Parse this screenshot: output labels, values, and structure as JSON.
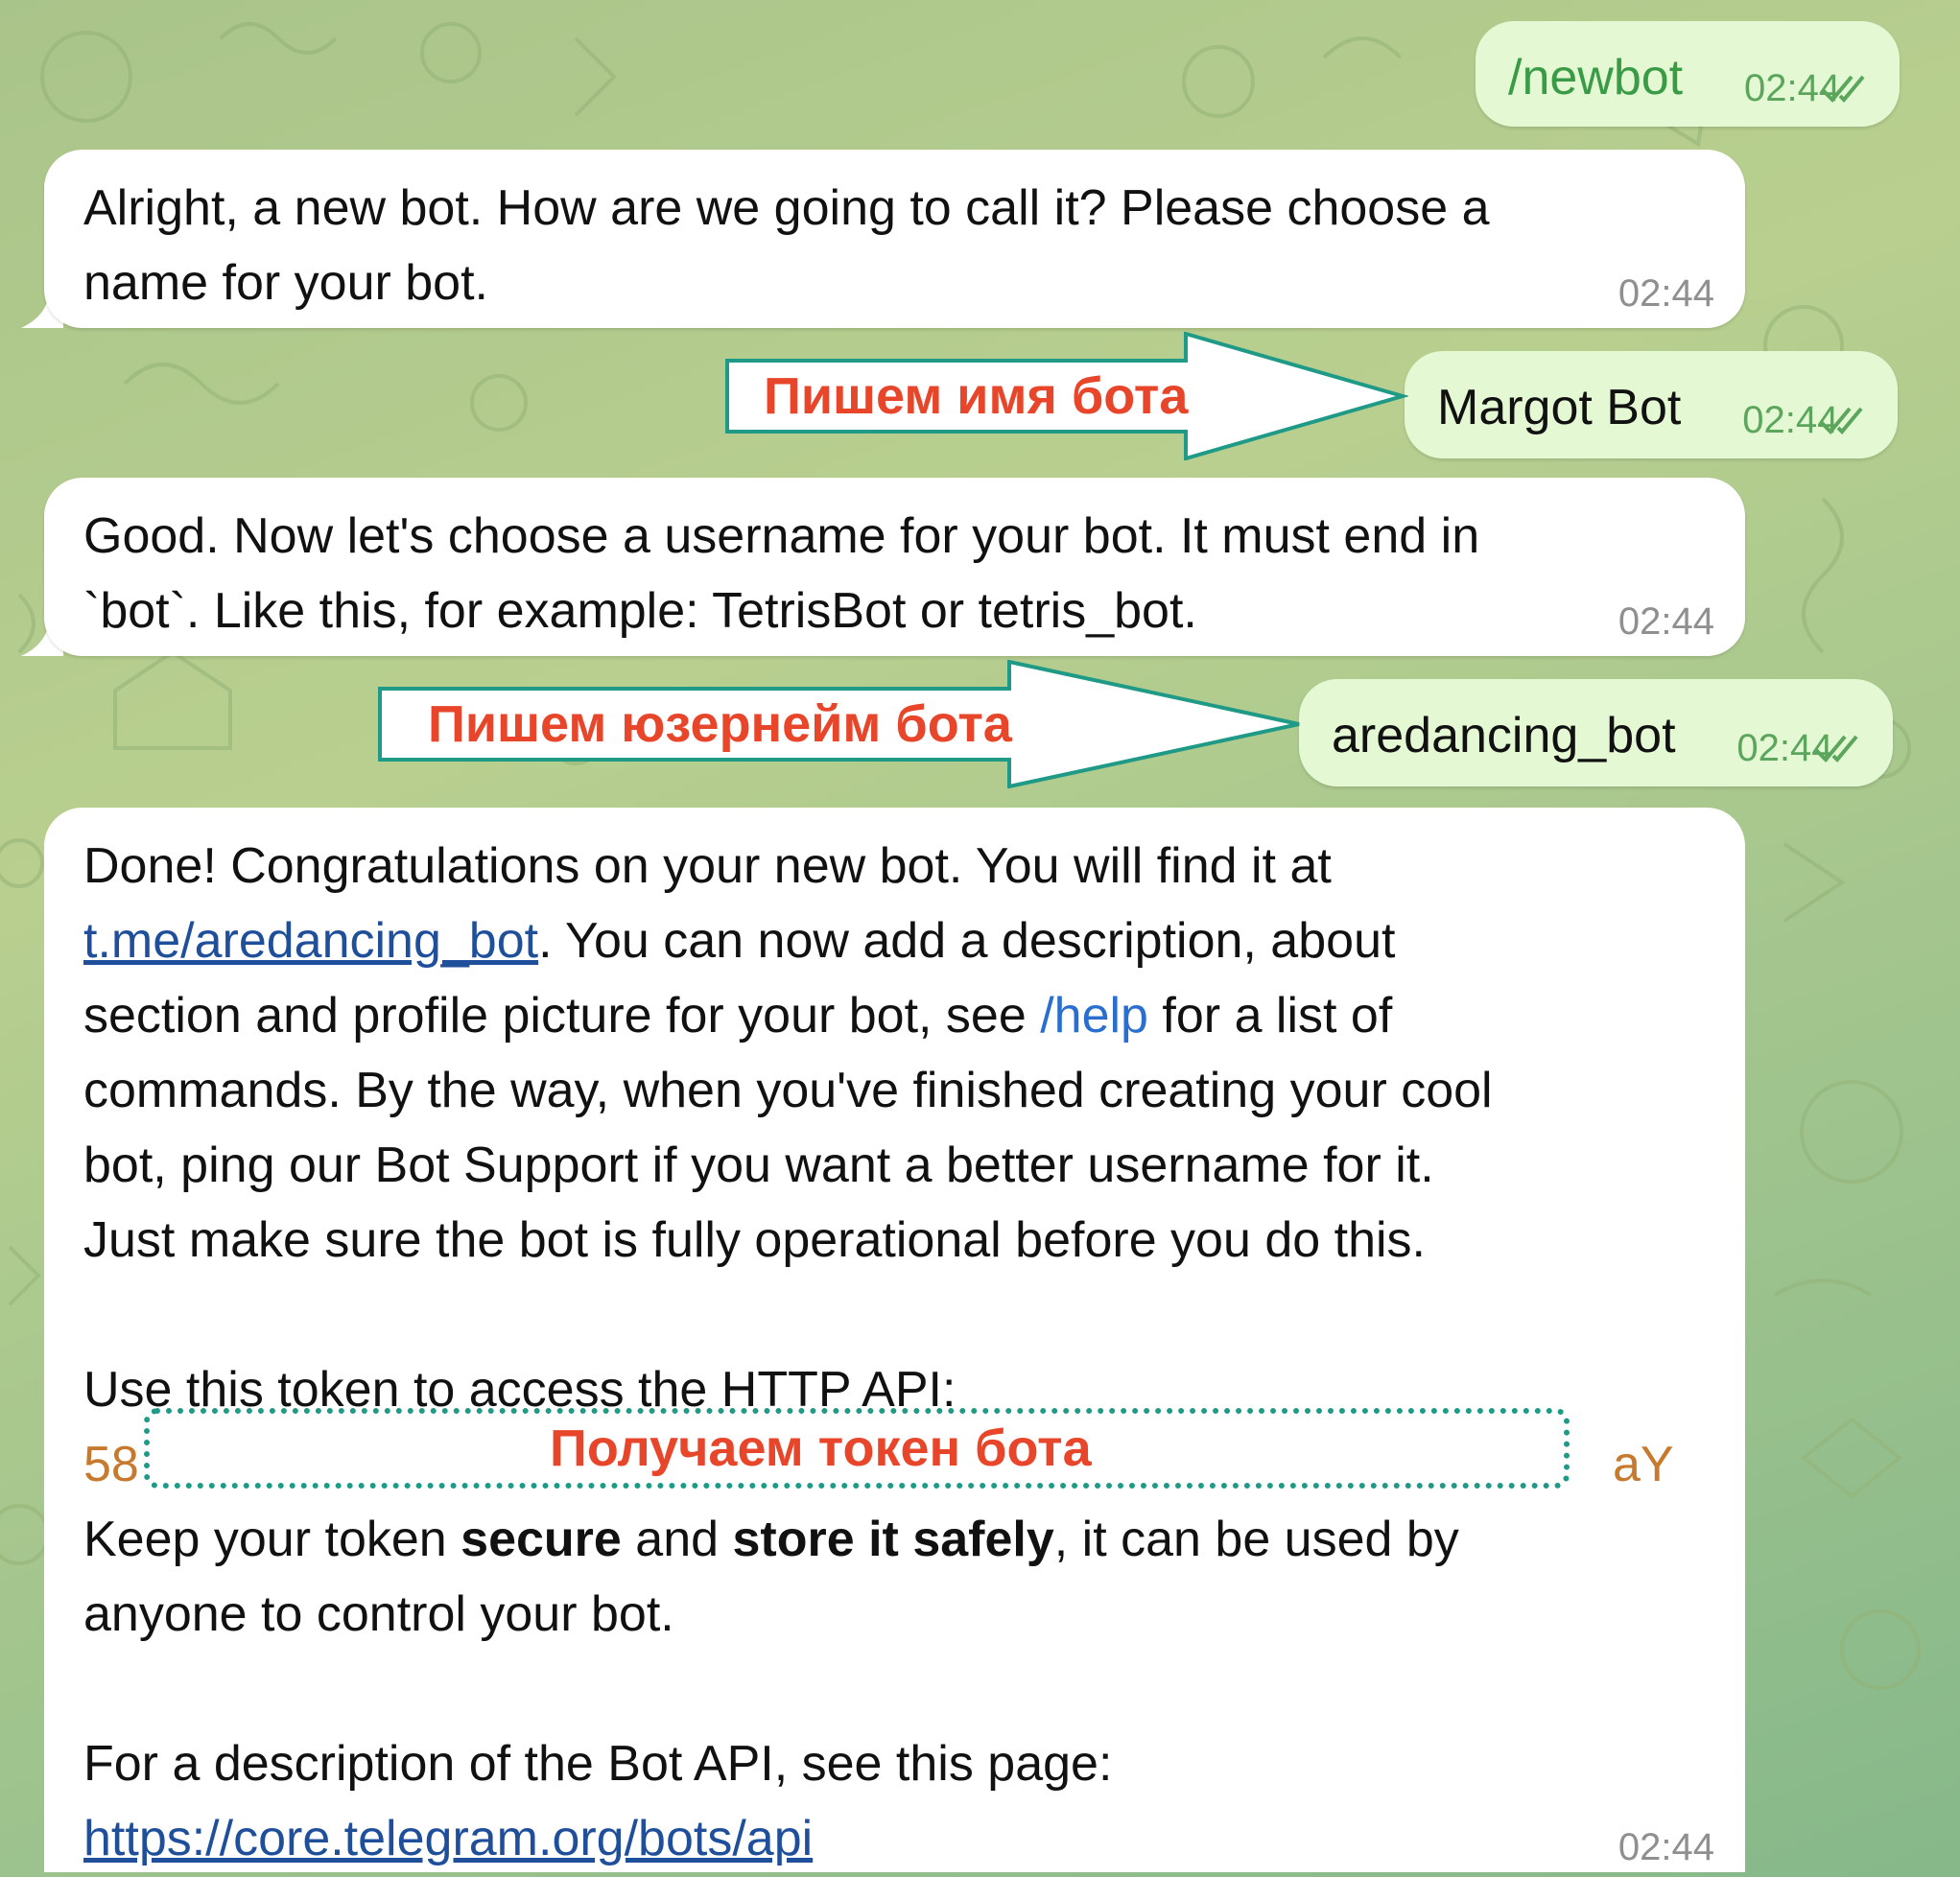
{
  "chat": {
    "messages": [
      {
        "from": "me",
        "text": "/newbot",
        "time": "02:44"
      },
      {
        "from": "bot",
        "lines": [
          "Alright, a new bot. How are we going to call it? Please choose a",
          "name for your bot."
        ],
        "time": "02:44"
      },
      {
        "from": "me",
        "text": "Margot Bot",
        "time": "02:44"
      },
      {
        "from": "bot",
        "lines": [
          "Good. Now let's choose a username for your bot. It must end in",
          "`bot`. Like this, for example: TetrisBot or tetris_bot."
        ],
        "time": "02:44"
      },
      {
        "from": "me",
        "text": "aredancing_bot",
        "time": "02:44"
      },
      {
        "from": "bot",
        "time": "02:44",
        "p1_a": "Done! Congratulations on your new bot. You will find it at",
        "link_bot": "t.me/aredancing_bot",
        "p1_b": ". You can now add a description, about",
        "p1_c": "section and profile picture for your bot, see ",
        "cmd_help": "/help",
        "p1_d": " for a list of",
        "p1_e": "commands. By the way, when you've finished creating your cool",
        "p1_f": "bot, ping our Bot Support if you want a better username for it.",
        "p1_g": "Just make sure the bot is fully operational before you do this.",
        "p2_a": "Use this token to access the HTTP API:",
        "token_start": "58",
        "token_end": "aY",
        "p2_b": "Keep your token ",
        "p2_bold1": "secure",
        "p2_c": " and ",
        "p2_bold2": "store it safely",
        "p2_d": ", it can be used by",
        "p2_e": "anyone to control your bot.",
        "p3_a": "For a description of the Bot API, see this page:",
        "link_api": "https://core.telegram.org/bots/api"
      }
    ]
  },
  "annotations": {
    "name": "Пишем имя бота",
    "username": "Пишем юзернейм бота",
    "token": "Получаем токен бота"
  },
  "colors": {
    "incoming_bubble": "#ffffff",
    "outgoing_bubble": "#e3f8d3",
    "annotation_text": "#e8462b",
    "annotation_outline": "#1f9a86",
    "link": "#1f4f9b",
    "token": "#c77a2e"
  }
}
